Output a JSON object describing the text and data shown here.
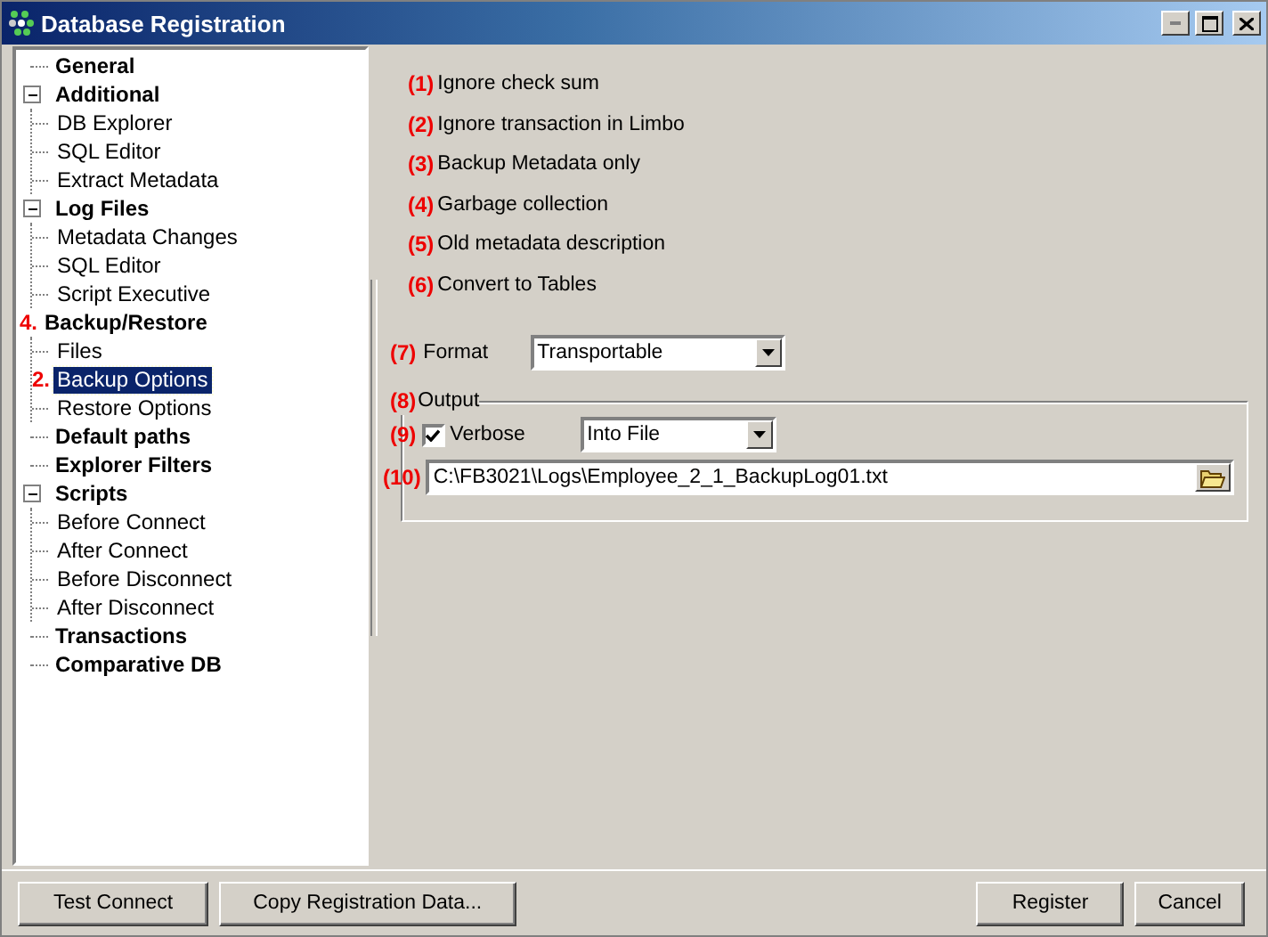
{
  "window": {
    "title": "Database Registration"
  },
  "tree": {
    "items": [
      {
        "label": "General",
        "selected": false
      },
      {
        "label": "Additional",
        "selected": false,
        "expanded": true,
        "children": [
          {
            "label": "DB Explorer",
            "selected": false
          },
          {
            "label": "SQL Editor",
            "selected": false
          },
          {
            "label": "Extract Metadata",
            "selected": false
          }
        ]
      },
      {
        "label": "Log Files",
        "selected": false,
        "expanded": true,
        "children": [
          {
            "label": "Metadata Changes",
            "selected": false
          },
          {
            "label": "SQL Editor",
            "selected": false
          },
          {
            "label": "Script Executive",
            "selected": false
          }
        ]
      },
      {
        "label": "Backup/Restore",
        "marker": "4.",
        "selected": false,
        "children": [
          {
            "label": "Files",
            "selected": false
          },
          {
            "label": "Backup Options",
            "marker": "2.",
            "selected": true
          },
          {
            "label": "Restore Options",
            "selected": false
          }
        ]
      },
      {
        "label": "Default paths",
        "selected": false
      },
      {
        "label": "Explorer Filters",
        "selected": false
      },
      {
        "label": "Scripts",
        "selected": false,
        "expanded": true,
        "children": [
          {
            "label": "Before Connect",
            "selected": false
          },
          {
            "label": "After Connect",
            "selected": false
          },
          {
            "label": "Before Disconnect",
            "selected": false
          },
          {
            "label": "After Disconnect",
            "selected": false
          }
        ]
      },
      {
        "label": "Transactions",
        "selected": false
      },
      {
        "label": "Comparative DB",
        "selected": false
      }
    ]
  },
  "options": [
    {
      "marker": "(1)",
      "label": "Ignore check sum"
    },
    {
      "marker": "(2)",
      "label": "Ignore transaction in Limbo"
    },
    {
      "marker": "(3)",
      "label": "Backup Metadata only"
    },
    {
      "marker": "(4)",
      "label": "Garbage collection"
    },
    {
      "marker": "(5)",
      "label": "Old metadata description"
    },
    {
      "marker": "(6)",
      "label": "Convert to Tables"
    }
  ],
  "format": {
    "marker": "(7)",
    "label": "Format",
    "value": "Transportable"
  },
  "output": {
    "marker": "(8)",
    "title": "Output",
    "verbose": {
      "marker": "(9)",
      "label": "Verbose",
      "checked": true,
      "mode": "Into File"
    },
    "path": {
      "marker": "(10)",
      "value": "C:\\FB3021\\Logs\\Employee_2_1_BackupLog01.txt"
    }
  },
  "buttons_left": [
    "Test Connect",
    "Copy Registration Data..."
  ],
  "buttons_right": [
    "Register",
    "Cancel"
  ]
}
